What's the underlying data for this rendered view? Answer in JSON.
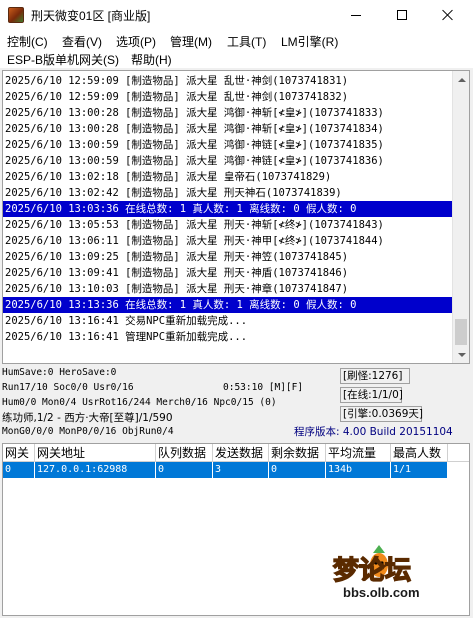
{
  "window": {
    "title": "刑天微变01区 [商业版]"
  },
  "menu": {
    "row1": [
      "控制(C)",
      "查看(V)",
      "选项(P)",
      "管理(M)",
      "工具(T)",
      "LM引擎(R)"
    ],
    "row2": [
      "ESP-B版单机网关(S)",
      "帮助(H)"
    ]
  },
  "log": {
    "lines": [
      "2025/6/10 12:59:09 [制造物品] 派大星 乱世·神剑(1073741831)",
      "2025/6/10 12:59:09 [制造物品] 派大星 乱世·神剑(1073741832)",
      "2025/6/10 13:00:28 [制造物品] 派大星 鸿御·神斩[≮皇≯](1073741833)",
      "2025/6/10 13:00:28 [制造物品] 派大星 鸿御·神斩[≮皇≯](1073741834)",
      "2025/6/10 13:00:59 [制造物品] 派大星 鸿御·神链[≮皇≯](1073741835)",
      "2025/6/10 13:00:59 [制造物品] 派大星 鸿御·神链[≮皇≯](1073741836)",
      "2025/6/10 13:02:18 [制造物品] 派大星 皇帝石(1073741829)",
      "2025/6/10 13:02:42 [制造物品] 派大星 刑天神石(1073741839)",
      "2025/6/10 13:03:36 在线总数: 1 真人数: 1 离线数: 0 假人数: 0",
      "2025/6/10 13:05:53 [制造物品] 派大星 刑天·神斩[≮终≯](1073741843)",
      "2025/6/10 13:06:11 [制造物品] 派大星 刑天·神甲[≮终≯](1073741844)",
      "2025/6/10 13:09:25 [制造物品] 派大星 刑天·神笠(1073741845)",
      "2025/6/10 13:09:41 [制造物品] 派大星 刑天·神盾(1073741846)",
      "2025/6/10 13:10:03 [制造物品] 派大星 刑天·神章(1073741847)",
      "2025/6/10 13:13:36 在线总数: 1 真人数: 1 离线数: 0 假人数: 0",
      "2025/6/10 13:16:41 交易NPC重新加载完成...",
      "2025/6/10 13:16:41 管理NPC重新加载完成..."
    ],
    "highlight_color": "#0000cc"
  },
  "status": {
    "line1": "HumSave:0 HeroSave:0",
    "line2_left": "Run17/10 Soc0/0 Usr0/16",
    "line2_time": "0:53:10 [M][F]",
    "line3": "Hum0/0 Mon0/4 UsrRot16/244 Merch0/16 Npc0/15 (0)",
    "line4": "练功师,1/2 - 西方·大帝[至尊]/1/590",
    "line5": "MonG0/0/0 MonP0/0/16 ObjRun0/4",
    "box_monster": "[刷怪:1276]",
    "box_online": "[在线:1/1/0]",
    "box_engine": "[引擎:0.0369天]",
    "version": "程序版本: 4.00 Build 20151104"
  },
  "gateway_table": {
    "columns": [
      "网关",
      "网关地址",
      "队列数据",
      "发送数据",
      "剩余数据",
      "平均流量",
      "最高人数"
    ],
    "rows": [
      [
        "0",
        "127.0.0.1:62988",
        "0",
        "3",
        "0",
        "134b",
        "1/1"
      ]
    ],
    "selected_color": "#0078d7"
  },
  "watermark": {
    "text": "梦论坛",
    "url": "bbs.olb.com"
  }
}
